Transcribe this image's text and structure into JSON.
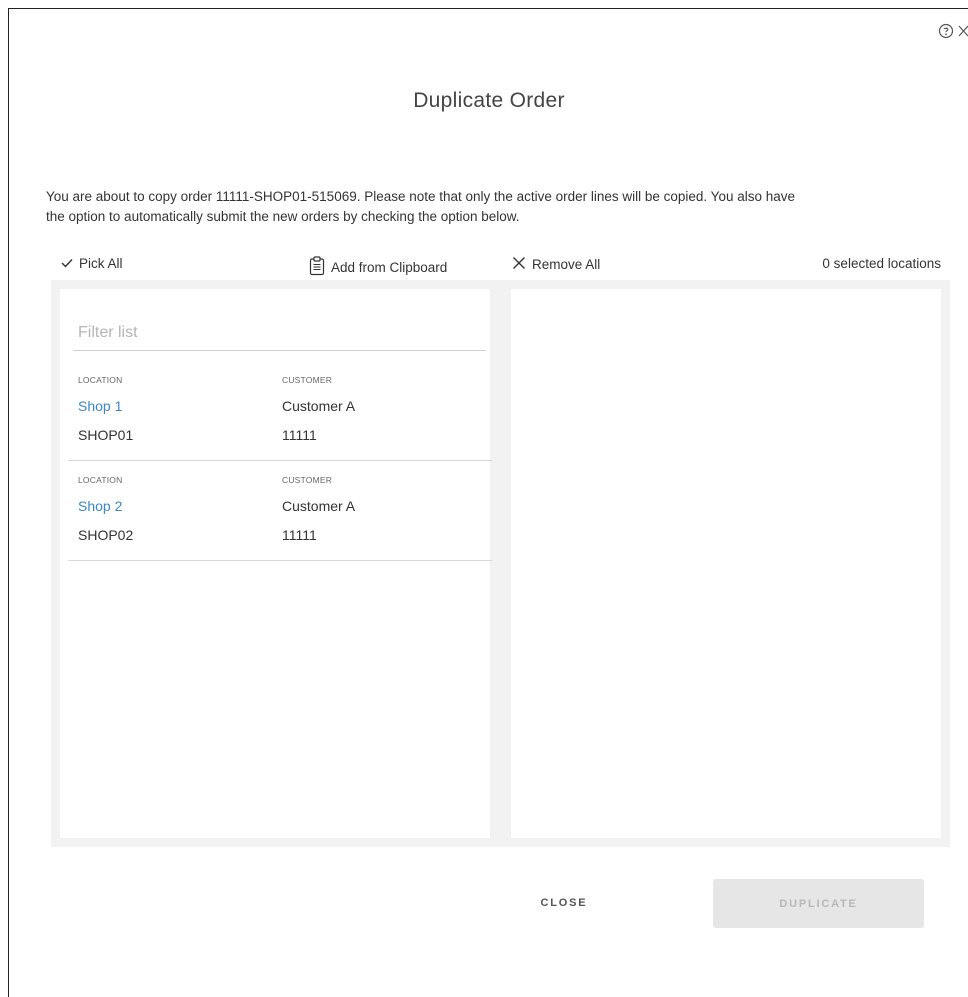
{
  "dialog": {
    "title": "Duplicate Order",
    "intro_line1": "You are about to copy order 11111-SHOP01-515069. Please note that only the active order lines will be copied. You also have",
    "intro_line2": "the option to automatically submit the new orders by checking the option below."
  },
  "toolbar": {
    "pick_all": "Pick All",
    "add_clipboard": "Add from Clipboard",
    "remove_all": "Remove All",
    "selected_count": "0 selected locations"
  },
  "filter": {
    "placeholder": "Filter list",
    "value": ""
  },
  "list": {
    "items": [
      {
        "location_header": "LOCATION",
        "customer_header": "CUSTOMER",
        "location_name": "Shop 1",
        "customer_name": "Customer A",
        "location_code": "SHOP01",
        "customer_code": "11111"
      },
      {
        "location_header": "LOCATION",
        "customer_header": "CUSTOMER",
        "location_name": "Shop 2",
        "customer_name": "Customer A",
        "location_code": "SHOP02",
        "customer_code": "11111"
      }
    ]
  },
  "footer": {
    "close_label": "CLOSE",
    "duplicate_label": "DUPLICATE"
  },
  "icons": {
    "help": "help-circle-icon",
    "close": "close-icon",
    "check": "check-icon",
    "clipboard": "clipboard-icon",
    "remove": "x-icon"
  },
  "colors": {
    "link": "#3a86c8",
    "disabled_button": "#e6e6e6",
    "panel_bg": "#f2f2f2"
  }
}
